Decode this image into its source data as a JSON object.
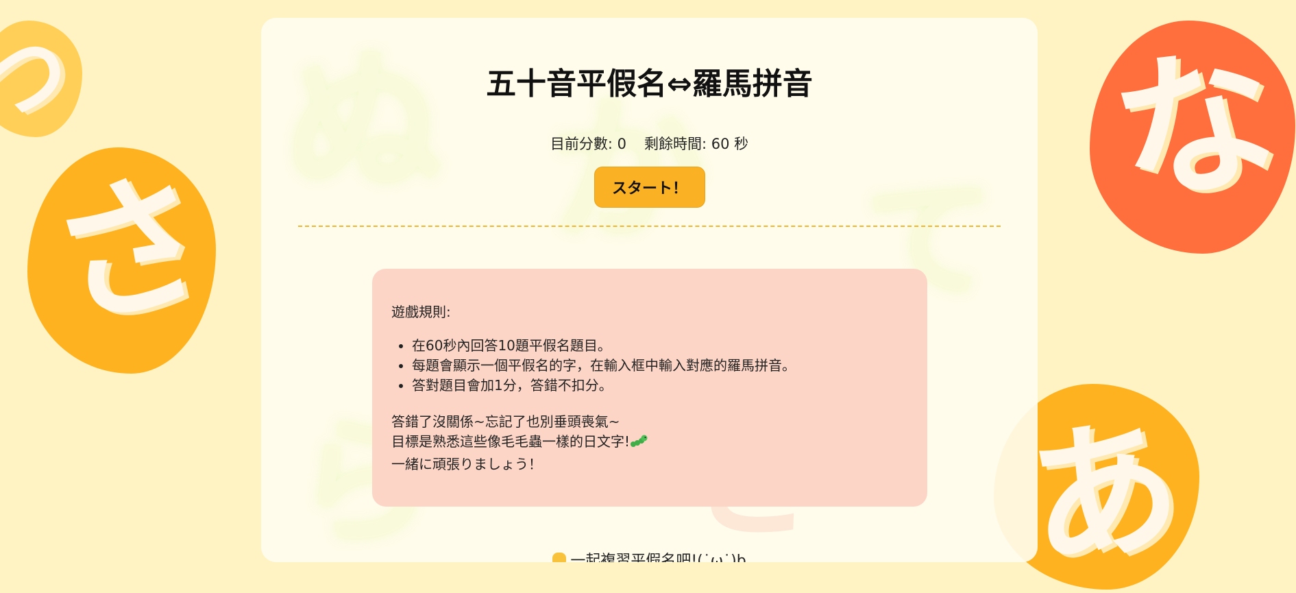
{
  "app": {
    "title": "五十音平假名⇔羅馬拼音"
  },
  "status": {
    "score_label": "目前分數: 0",
    "time_label": "剩餘時間: 60 秒"
  },
  "start_button": {
    "label": "スタート！"
  },
  "rules": {
    "heading": "遊戲規則:",
    "items": [
      "在60秒內回答10題平假名題目。",
      "每題會顯示一個平假名的字，在輸入框中輸入對應的羅馬拼音。",
      "答對題目會加1分，答錯不扣分。"
    ],
    "encouragement": [
      "答錯了沒關係~忘記了也別垂頭喪氣~",
      "目標是熟悉這些像毛毛蟲一樣的日文字!",
      "一緒に頑張りましょう！"
    ]
  },
  "footer": {
    "text": "一起複習平假名吧!(˙ω˙)b"
  },
  "decorations": {
    "left_top": "つ",
    "left_mid": "さ",
    "right_top": "な",
    "right_bottom": "あ",
    "card_ghosts": [
      "ぬ",
      "か",
      "て",
      "ら",
      "き"
    ]
  },
  "colors": {
    "background": "#fff3c4",
    "accent": "#fbb124",
    "rules_box": "#fdd5c6",
    "divider": "#f1b534"
  },
  "icons": {
    "footer": "hand-icon",
    "rules": "caterpillar-icon"
  }
}
